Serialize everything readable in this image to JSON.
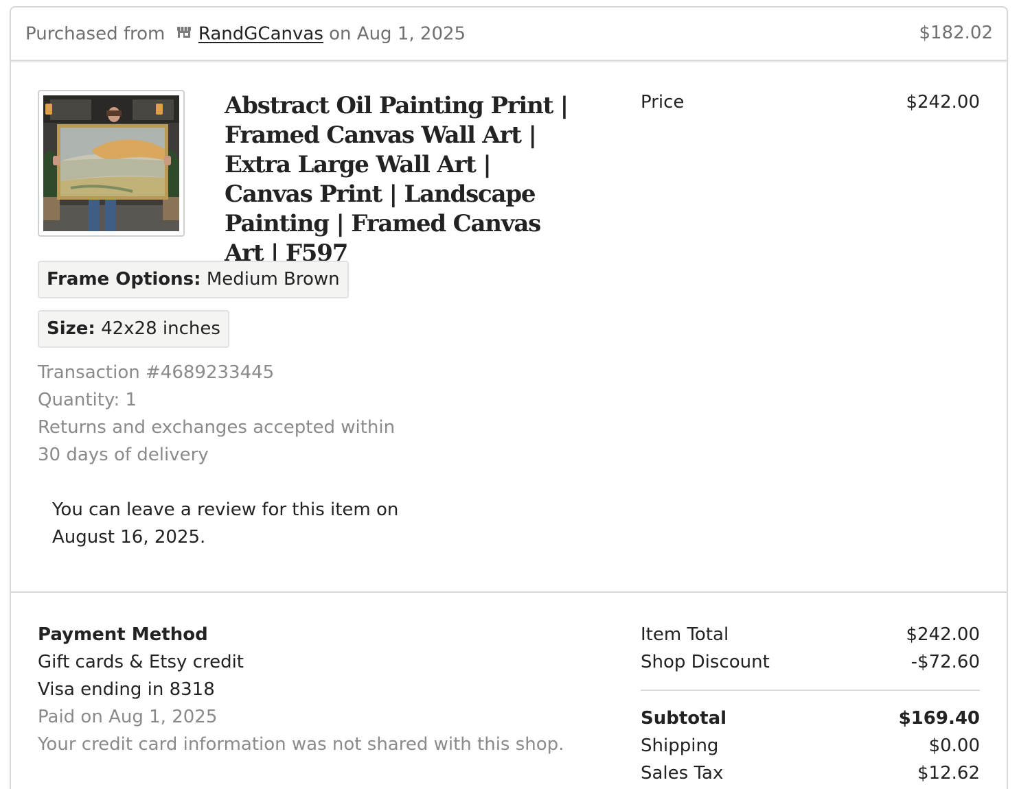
{
  "header": {
    "purchased_from_label": "Purchased from",
    "shop_name": "RandGCanvas",
    "on_date": "on Aug 1, 2025",
    "order_total": "$182.02",
    "shop_icon": "storefront-icon"
  },
  "item": {
    "image_alt": "woman holding framed abstract landscape painting",
    "title": "Abstract Oil Painting Print | Framed Canvas Wall Art | Extra Large Wall Art | Canvas Print | Landscape Painting | Framed Canvas Art | F597",
    "price_label": "Price",
    "price": "$242.00",
    "variations": [
      {
        "label": "Frame Options:",
        "value": "Medium Brown"
      },
      {
        "label": "Size:",
        "value": "42x28 inches"
      }
    ],
    "transaction": "Transaction #4689233445",
    "quantity": "Quantity: 1",
    "returns_line1": "Returns and exchanges accepted within",
    "returns_line2": "30 days of delivery",
    "review_line1": "You can leave a review for this item on",
    "review_line2": "August 16, 2025."
  },
  "payment": {
    "heading": "Payment Method",
    "method1": "Gift cards & Etsy credit",
    "method2": "Visa ending in 8318",
    "paid_on": "Paid on Aug 1, 2025",
    "privacy_note": "Your credit card information was not shared with this shop."
  },
  "totals": {
    "item_total_label": "Item Total",
    "item_total": "$242.00",
    "shop_discount_label": "Shop Discount",
    "shop_discount": "-$72.60",
    "subtotal_label": "Subtotal",
    "subtotal": "$169.40",
    "shipping_label": "Shipping",
    "shipping": "$0.00",
    "sales_tax_label": "Sales Tax",
    "sales_tax": "$12.62"
  },
  "colors": {
    "text": "#222222",
    "muted": "#8a8a8a",
    "border": "#d8d8d8",
    "chip_bg": "#f4f4f2"
  }
}
